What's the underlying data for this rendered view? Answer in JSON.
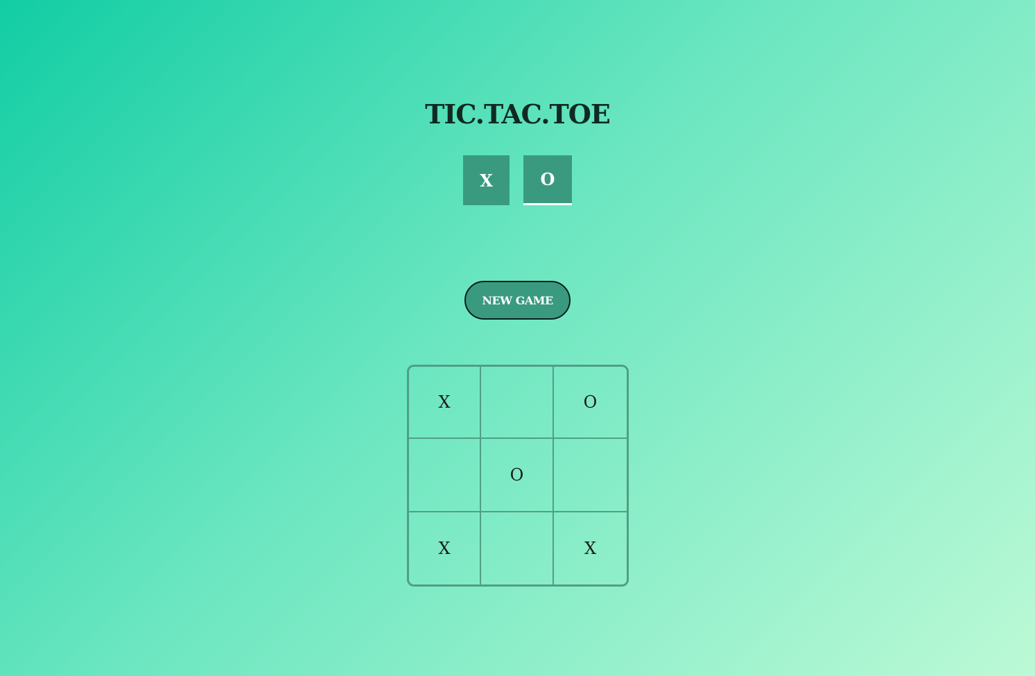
{
  "title": "TIC.TAC.TOE",
  "player_select": {
    "x_label": "X",
    "o_label": "O",
    "selected": "O"
  },
  "new_game_label": "NEW GAME",
  "board": {
    "cells": [
      "X",
      "",
      "O",
      "",
      "O",
      "",
      "X",
      "",
      "X"
    ]
  },
  "colors": {
    "background_start": "#12cda4",
    "background_end": "#bcf9d6",
    "button": "#3a9a80",
    "grid_line": "#4f9f86"
  }
}
